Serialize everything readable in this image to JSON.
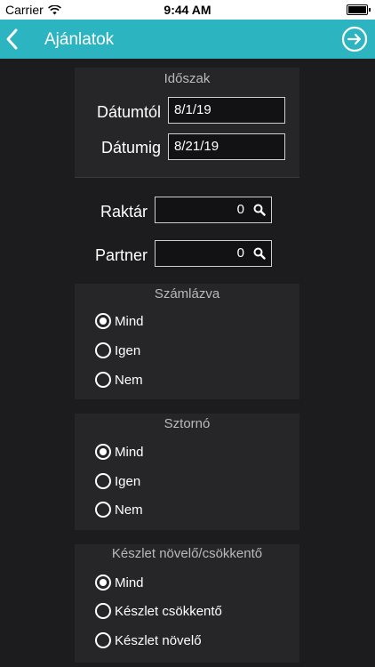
{
  "status_bar": {
    "carrier": "Carrier",
    "time": "9:44 AM"
  },
  "navbar": {
    "title": "Ajánlatok"
  },
  "period": {
    "title": "Időszak",
    "from_label": "Dátumtól",
    "from_value": "8/1/19",
    "to_label": "Dátumig",
    "to_value": "8/21/19"
  },
  "warehouse": {
    "label": "Raktár",
    "value": "0"
  },
  "partner": {
    "label": "Partner",
    "value": "0"
  },
  "invoiced": {
    "title": "Számlázva",
    "options": [
      {
        "label": "Mind",
        "selected": true
      },
      {
        "label": "Igen",
        "selected": false
      },
      {
        "label": "Nem",
        "selected": false
      }
    ]
  },
  "storno": {
    "title": "Sztornó",
    "options": [
      {
        "label": "Mind",
        "selected": true
      },
      {
        "label": "Igen",
        "selected": false
      },
      {
        "label": "Nem",
        "selected": false
      }
    ]
  },
  "stock": {
    "title": "Készlet növelő/csökkentő",
    "options": [
      {
        "label": "Mind",
        "selected": true
      },
      {
        "label": "Készlet csökkentő",
        "selected": false
      },
      {
        "label": "Készlet növelő",
        "selected": false
      }
    ]
  }
}
